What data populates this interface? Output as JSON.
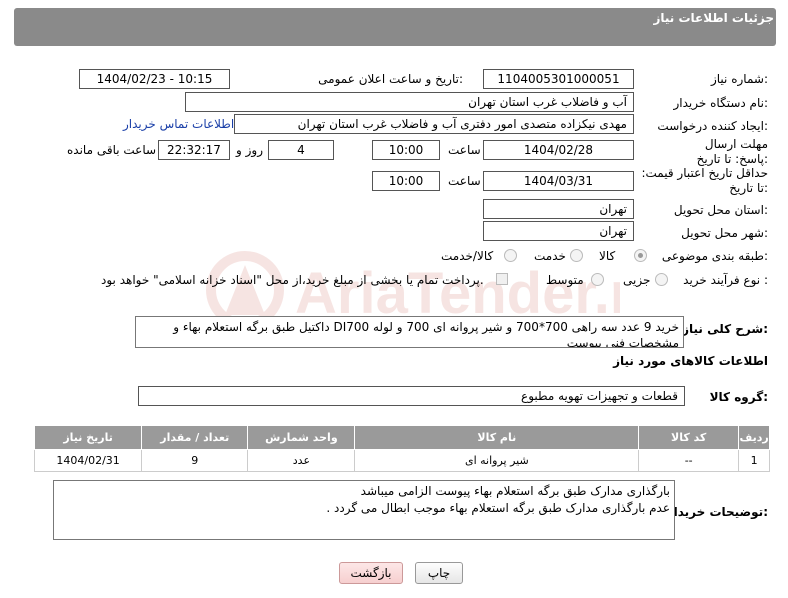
{
  "header": {
    "title": "جزئیات اطلاعات نیاز"
  },
  "fields": {
    "need_number_label": "شماره نیاز:",
    "need_number": "1104005301000051",
    "announce_label": "تاریخ و ساعت اعلان عمومی:",
    "announce_value": "1404/02/23 - 10:15",
    "buyer_org_label": "نام دستگاه خریدار:",
    "buyer_org": "آب و فاضلاب غرب استان تهران",
    "creator_label": "ایجاد کننده درخواست:",
    "creator": "مهدی نیکزاده متصدی امور دفتری آب و فاضلاب غرب استان تهران",
    "contact_link": "اطلاعات تماس خریدار",
    "reply_deadline_label": "مهلت ارسال پاسخ: تا تاریخ:",
    "reply_date": "1404/02/28",
    "time_label": "ساعت",
    "reply_time": "10:00",
    "days_value": "4",
    "days_label": "روز و",
    "remaining_time": "22:32:17",
    "remaining_label": "ساعت باقی مانده",
    "price_validity_label": "حداقل تاریخ اعتبار قیمت: تا تاریخ:",
    "price_date": "1404/03/31",
    "price_time": "10:00",
    "province_label": "استان محل تحویل:",
    "province": "تهران",
    "city_label": "شهر محل تحویل:",
    "city": "تهران",
    "category_label": "طبقه بندی موضوعی:",
    "category_options": [
      "کالا",
      "خدمت",
      "کالا/خدمت"
    ],
    "process_label": "نوع فرآیند خرید :",
    "process_options": [
      "جزیی",
      "متوسط"
    ],
    "payment_note": "پرداخت تمام یا بخشی از مبلغ خرید،از محل \"اسناد خزانه اسلامی\" خواهد بود.",
    "description_label": "شرح کلی نیاز:",
    "description": "خرید 9 عدد سه راهی 700*700 و شیر پروانه ای 700 و لوله DI700 داکتیل طبق برگه استعلام بهاء و مشخصات فنی پیوست"
  },
  "goods": {
    "section_title": "اطلاعات کالاهای مورد نیاز",
    "group_label": "گروه کالا:",
    "group_value": "قطعات و تجهیزات تهویه مطبوع",
    "columns": [
      "ردیف",
      "کد کالا",
      "نام کالا",
      "واحد شمارش",
      "تعداد / مقدار",
      "تاریخ نیاز"
    ],
    "rows": [
      [
        "1",
        "--",
        "شیر پروانه ای",
        "عدد",
        "9",
        "1404/02/31"
      ]
    ]
  },
  "buyer_notes": {
    "label": "توضیحات خریدار:",
    "line1": "بارگذاری مدارک طبق برگه استعلام بهاء پیوست الزامی میباشد",
    "line2": "عدم بارگذاری مدارک طبق برگه  استعلام بهاء موجب ابطال می گردد ."
  },
  "buttons": {
    "print": "چاپ",
    "back": "بازگشت"
  },
  "watermark": {
    "text": "AriaTender.neT",
    "color": "#c0392b"
  }
}
